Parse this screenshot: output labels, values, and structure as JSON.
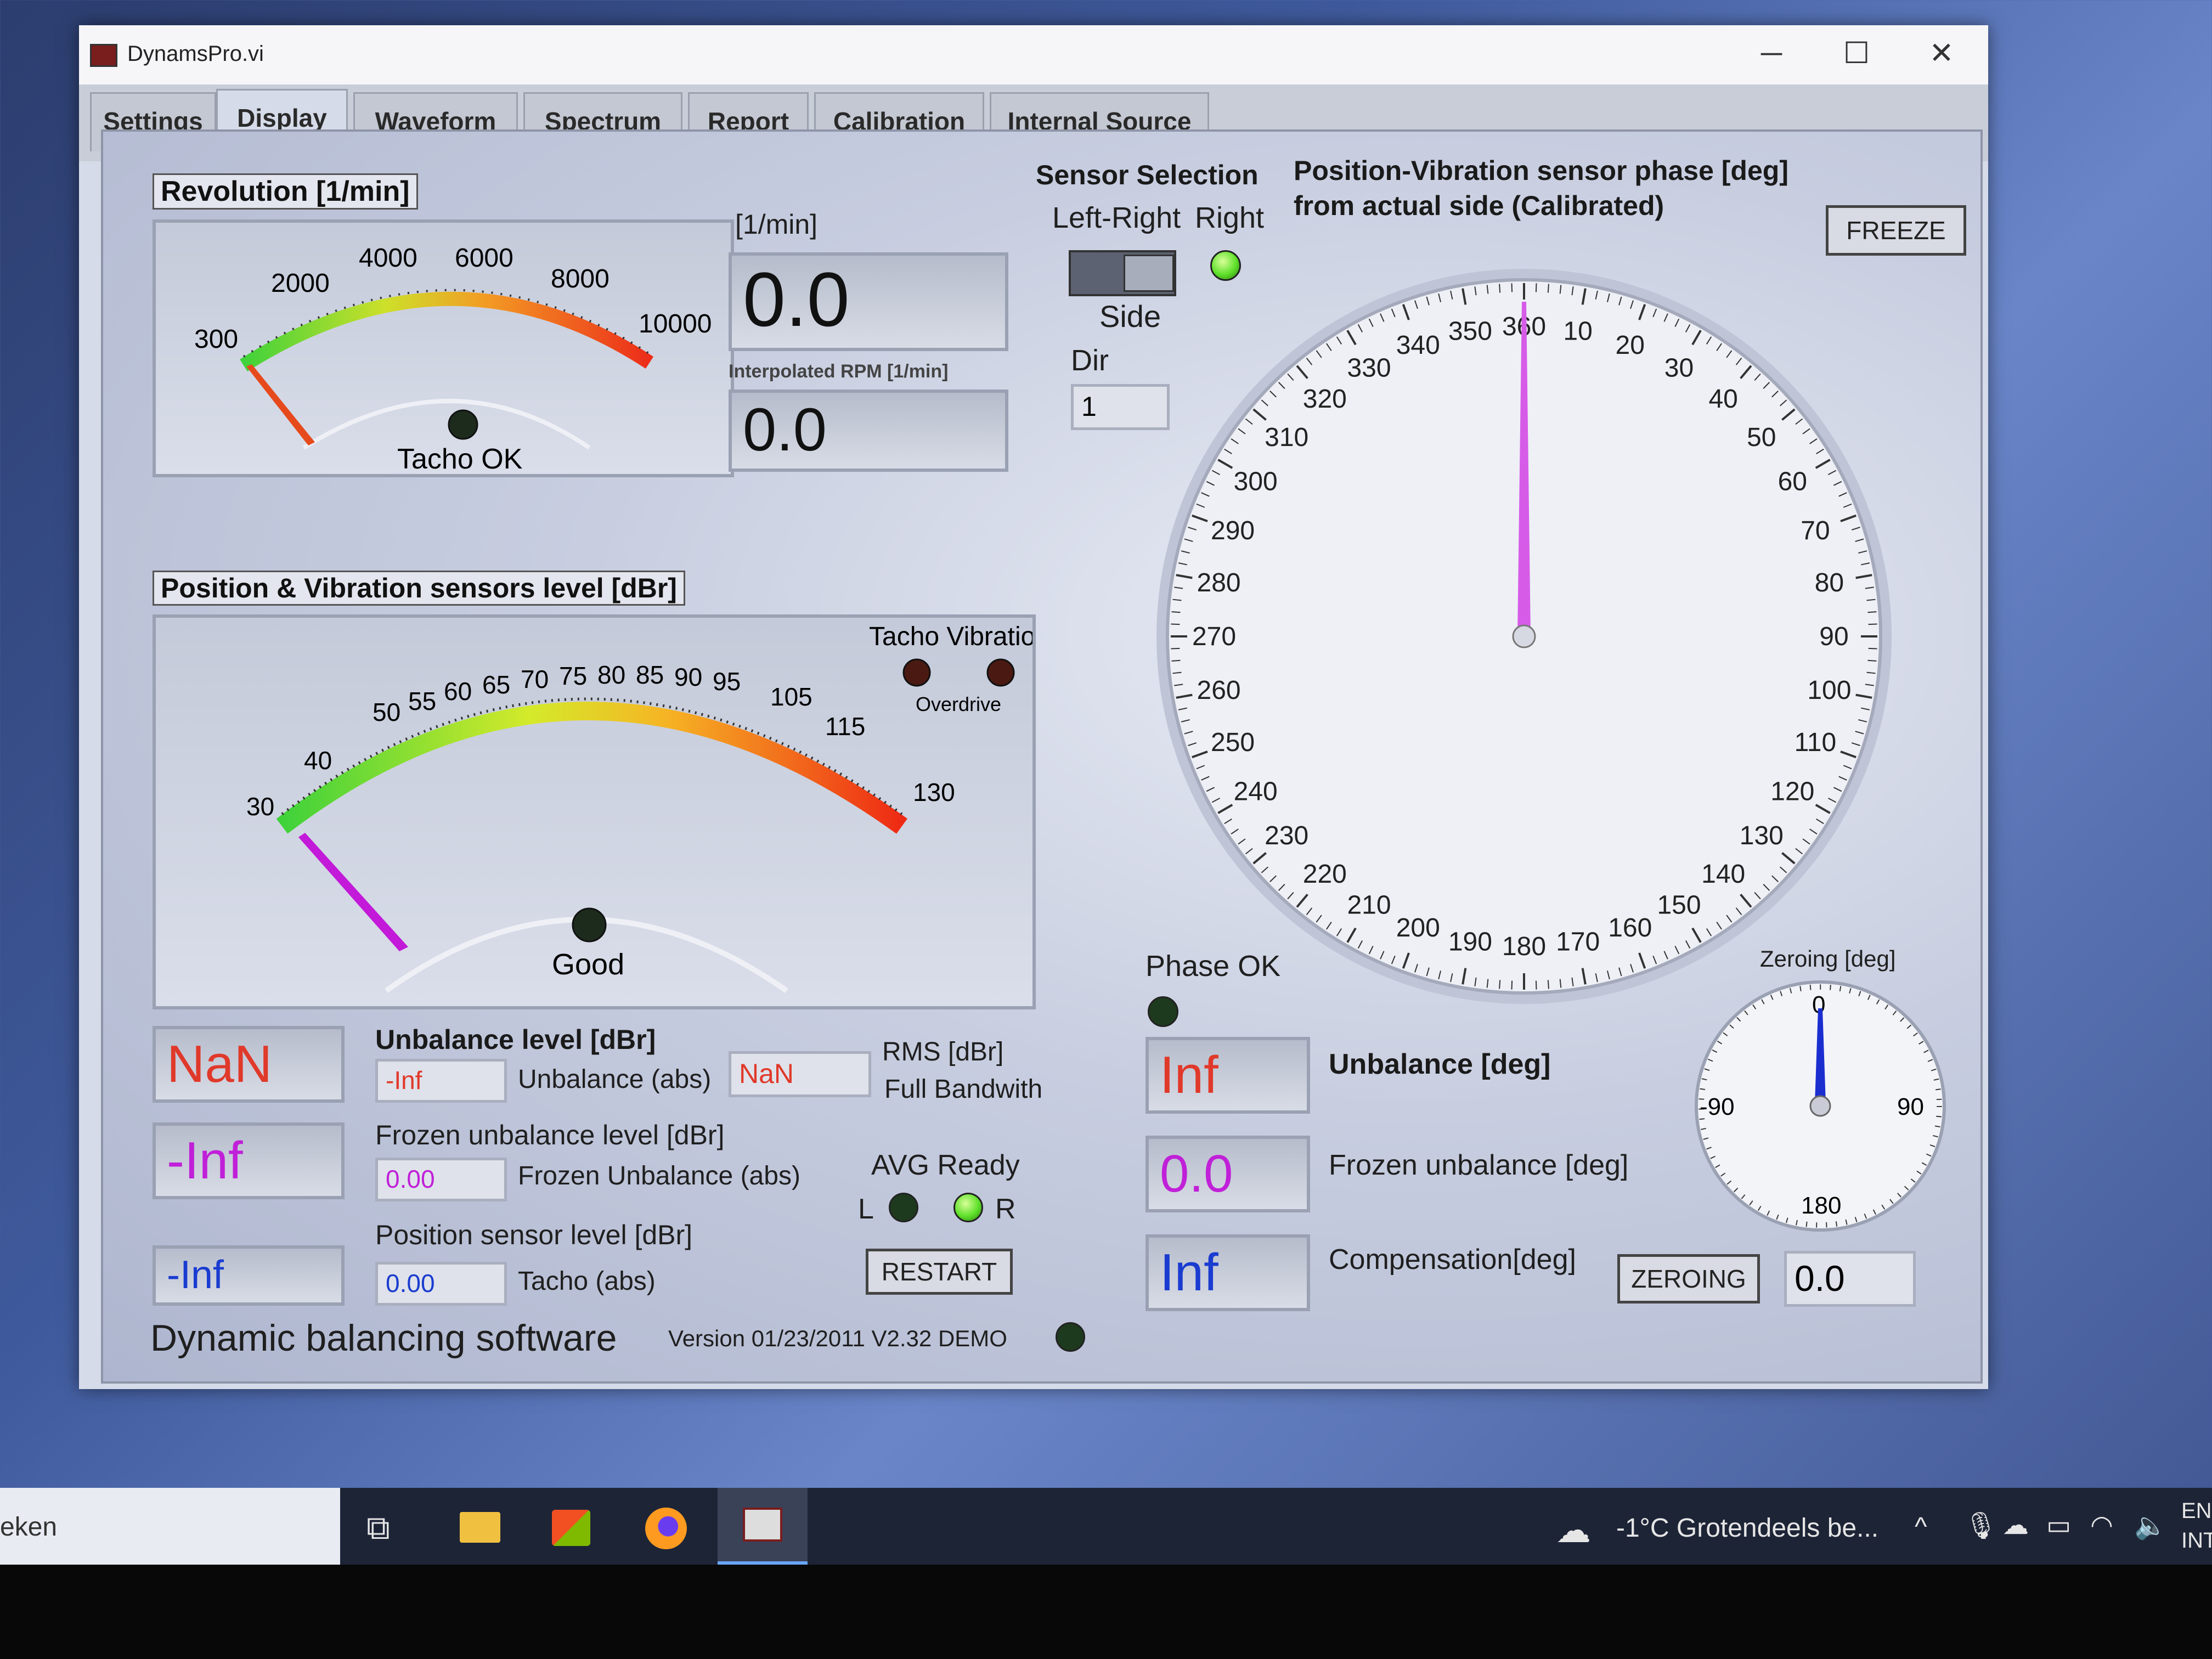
{
  "window": {
    "title": "DynamsPro.vi",
    "controls": {
      "minimize": "─",
      "maximize": "☐",
      "close": "✕"
    }
  },
  "tabs": [
    {
      "label": "Settings"
    },
    {
      "label": "Display"
    },
    {
      "label": "Waveform"
    },
    {
      "label": "Spectrum"
    },
    {
      "label": "Report"
    },
    {
      "label": "Calibration"
    },
    {
      "label": "Internal Source"
    }
  ],
  "active_tab": "Display",
  "revolution": {
    "title": "Revolution [1/min]",
    "ticks": [
      "300",
      "2000",
      "4000",
      "6000",
      "8000",
      "10000"
    ],
    "tacho_label": "Tacho OK",
    "unit_label": "[1/min]",
    "rpm_value": "0.0",
    "interp_label": "Interpolated RPM [1/min]",
    "interp_value": "0.0"
  },
  "sensor_selection": {
    "title": "Sensor Selection",
    "left_right": "Left-Right",
    "right": "Right",
    "side": "Side",
    "dir_label": "Dir",
    "dir_value": "1"
  },
  "phase": {
    "title_line1": "Position-Vibration sensor phase [deg]",
    "title_line2": "from actual side (Calibrated)",
    "freeze_label": "FREEZE",
    "ticks": [
      "360",
      "10",
      "20",
      "30",
      "40",
      "50",
      "60",
      "70",
      "80",
      "90",
      "100",
      "110",
      "120",
      "130",
      "140",
      "150",
      "160",
      "170",
      "180",
      "190",
      "200",
      "210",
      "220",
      "230",
      "240",
      "250",
      "260",
      "270",
      "280",
      "290",
      "300",
      "310",
      "320",
      "330",
      "340",
      "350"
    ],
    "needle_deg": 0,
    "phase_ok": "Phase OK"
  },
  "level": {
    "title": "Position & Vibration sensors level [dBr]",
    "tacho_vibration": "Tacho Vibration",
    "overdrive": "Overdrive",
    "ticks": [
      "30",
      "40",
      "50",
      "55",
      "60",
      "65",
      "70",
      "75",
      "80",
      "85",
      "90",
      "95",
      "105",
      "115",
      "130"
    ],
    "good": "Good"
  },
  "unbalance": {
    "big_value": "NaN",
    "level_title": "Unbalance level [dBr]",
    "abs_value": "-Inf",
    "abs_label": "Unbalance (abs)",
    "rms_value": "NaN",
    "rms_label": "RMS [dBr]",
    "full_bw": "Full Bandwith",
    "frozen_big": "-Inf",
    "frozen_title": "Frozen unbalance level [dBr]",
    "frozen_abs_value": "0.00",
    "frozen_abs_label": "Frozen Unbalance (abs)",
    "pos_big": "-Inf",
    "pos_title": "Position sensor level [dBr]",
    "pos_abs_value": "0.00",
    "tacho_abs_label": "Tacho (abs)",
    "avg_ready": "AVG Ready",
    "avg_l": "L",
    "avg_r": "R",
    "restart": "RESTART"
  },
  "degrees": {
    "unb_value": "Inf",
    "unb_label": "Unbalance [deg]",
    "frozen_value": "0.0",
    "frozen_label": "Frozen unbalance [deg]",
    "comp_value": "Inf",
    "comp_label": "Compensation[deg]",
    "zeroing_btn": "ZEROING",
    "zeroing_value": "0.0",
    "zeroing_title": "Zeroing [deg]",
    "zero_ticks": [
      "0",
      "90",
      "180",
      "-90"
    ]
  },
  "footer": {
    "app_name": "Dynamic balancing software",
    "version": "Version 01/23/2011 V2.32 DEMO"
  },
  "taskbar": {
    "search_partial": "eken",
    "weather": "-1°C  Grotendeels be...",
    "lang1": "EN",
    "lang2": "INT"
  },
  "colors": {
    "red_text": "#e0392a",
    "magenta_text": "#c020d8",
    "blue_text": "#1a3cd0",
    "needle_magenta": "#d65ce8",
    "led_green": "#5ee02a",
    "led_dark": "#1e3a1e"
  }
}
